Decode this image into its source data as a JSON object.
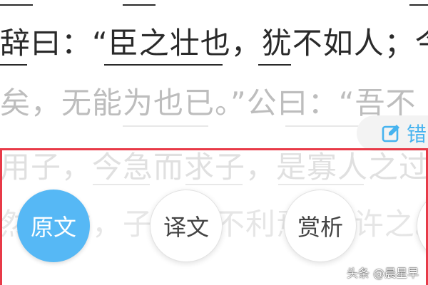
{
  "reading": {
    "line1": "辞曰：“臣之壮也，犹不如人；今",
    "line2": "矣，无能为也已。”公曰：“吾不",
    "line3": "用子，今急而求子，是寡人之过",
    "line4": "然郑亡，子亦有不利焉！”许之。"
  },
  "error_report": {
    "icon": "pen-square-icon",
    "label": "错",
    "accent": "#46b3ef"
  },
  "modes": {
    "active_color": "#56b8f5",
    "items": [
      {
        "label": "原文",
        "active": true
      },
      {
        "label": "译文",
        "active": false
      },
      {
        "label": "赏析",
        "active": false
      },
      {
        "label": "",
        "active": false
      }
    ]
  },
  "highlight": {
    "color": "#e83a48"
  },
  "watermark": {
    "text": "头条 @晨星早"
  }
}
